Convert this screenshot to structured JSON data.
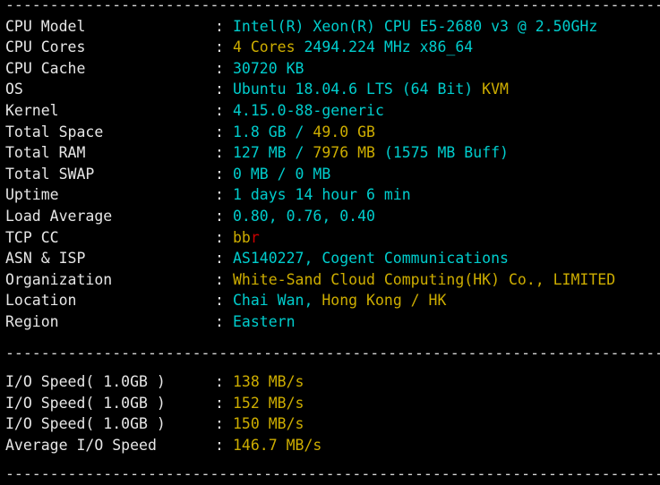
{
  "terminal": {
    "separator_top": "--------------------------------------------------------------------------",
    "separator_mid": "--------------------------------------------------------------------------",
    "separator_bottom": "--------------------------------------------------------------------------",
    "colon": ":",
    "colors": {
      "background": "#000000",
      "label": "#e6e6e6",
      "cyan": "#00cdcd",
      "gold": "#cdad00",
      "red": "#cd0000"
    }
  },
  "system_info": {
    "rows": [
      {
        "label": "CPU Model",
        "value_full": "Intel(R) Xeon(R) CPU E5-2680 v3 @ 2.50GHz",
        "segments": [
          {
            "text": "Intel(R) Xeon(R) CPU E5-2680 v3 @ 2.50GHz",
            "color": "cyan"
          }
        ]
      },
      {
        "label": "CPU Cores",
        "value_full": "4 Cores 2494.224 MHz x86_64",
        "segments": [
          {
            "text": "4 Cores ",
            "color": "gold"
          },
          {
            "text": "2494.224 MHz x86_64",
            "color": "cyan"
          }
        ]
      },
      {
        "label": "CPU Cache",
        "value_full": "30720 KB",
        "segments": [
          {
            "text": "30720 KB",
            "color": "cyan"
          }
        ]
      },
      {
        "label": "OS",
        "value_full": "Ubuntu 18.04.6 LTS (64 Bit) KVM",
        "segments": [
          {
            "text": "Ubuntu 18.04.6 LTS (64 Bit) ",
            "color": "cyan"
          },
          {
            "text": "KVM",
            "color": "gold"
          }
        ]
      },
      {
        "label": "Kernel",
        "value_full": "4.15.0-88-generic",
        "segments": [
          {
            "text": "4.15.0-88-generic",
            "color": "cyan"
          }
        ]
      },
      {
        "label": "Total Space",
        "value_full": "1.8 GB / 49.0 GB",
        "segments": [
          {
            "text": "1.8 GB / ",
            "color": "cyan"
          },
          {
            "text": "49.0 GB",
            "color": "gold"
          }
        ]
      },
      {
        "label": "Total RAM",
        "value_full": "127 MB / 7976 MB (1575 MB Buff)",
        "segments": [
          {
            "text": "127 MB / ",
            "color": "cyan"
          },
          {
            "text": "7976 MB ",
            "color": "gold"
          },
          {
            "text": "(1575 MB Buff)",
            "color": "cyan"
          }
        ]
      },
      {
        "label": "Total SWAP",
        "value_full": "0 MB / 0 MB",
        "segments": [
          {
            "text": "0 MB / 0 MB",
            "color": "cyan"
          }
        ]
      },
      {
        "label": "Uptime",
        "value_full": "1 days 14 hour 6 min",
        "segments": [
          {
            "text": "1 days 14 hour 6 min",
            "color": "cyan"
          }
        ]
      },
      {
        "label": "Load Average",
        "value_full": "0.80, 0.76, 0.40",
        "segments": [
          {
            "text": "0.80, 0.76, 0.40",
            "color": "cyan"
          }
        ]
      },
      {
        "label": "TCP CC",
        "value_full": "bbr",
        "segments": [
          {
            "text": "bb",
            "color": "gold"
          },
          {
            "text": "r",
            "color": "red"
          }
        ]
      },
      {
        "label": "ASN & ISP",
        "value_full": "AS140227, Cogent Communications",
        "segments": [
          {
            "text": "AS140227, Cogent Communications",
            "color": "cyan"
          }
        ]
      },
      {
        "label": "Organization",
        "value_full": "White-Sand Cloud Computing(HK) Co., LIMITED",
        "segments": [
          {
            "text": "White-Sand Cloud Computing(HK) Co., LIMITED",
            "color": "gold"
          }
        ]
      },
      {
        "label": "Location",
        "value_full": "Chai Wan, Hong Kong / HK",
        "segments": [
          {
            "text": "Chai Wan, ",
            "color": "cyan"
          },
          {
            "text": "Hong Kong / HK",
            "color": "gold"
          }
        ]
      },
      {
        "label": "Region",
        "value_full": "Eastern",
        "segments": [
          {
            "text": "Eastern",
            "color": "cyan"
          }
        ]
      }
    ]
  },
  "io_test": {
    "rows": [
      {
        "label": "I/O Speed( 1.0GB )",
        "value_full": "138 MB/s",
        "segments": [
          {
            "text": "138 MB/s",
            "color": "gold"
          }
        ]
      },
      {
        "label": "I/O Speed( 1.0GB )",
        "value_full": "152 MB/s",
        "segments": [
          {
            "text": "152 MB/s",
            "color": "gold"
          }
        ]
      },
      {
        "label": "I/O Speed( 1.0GB )",
        "value_full": "150 MB/s",
        "segments": [
          {
            "text": "150 MB/s",
            "color": "gold"
          }
        ]
      },
      {
        "label": "Average I/O Speed",
        "value_full": "146.7 MB/s",
        "segments": [
          {
            "text": "146.7 MB/s",
            "color": "gold"
          }
        ]
      }
    ]
  }
}
